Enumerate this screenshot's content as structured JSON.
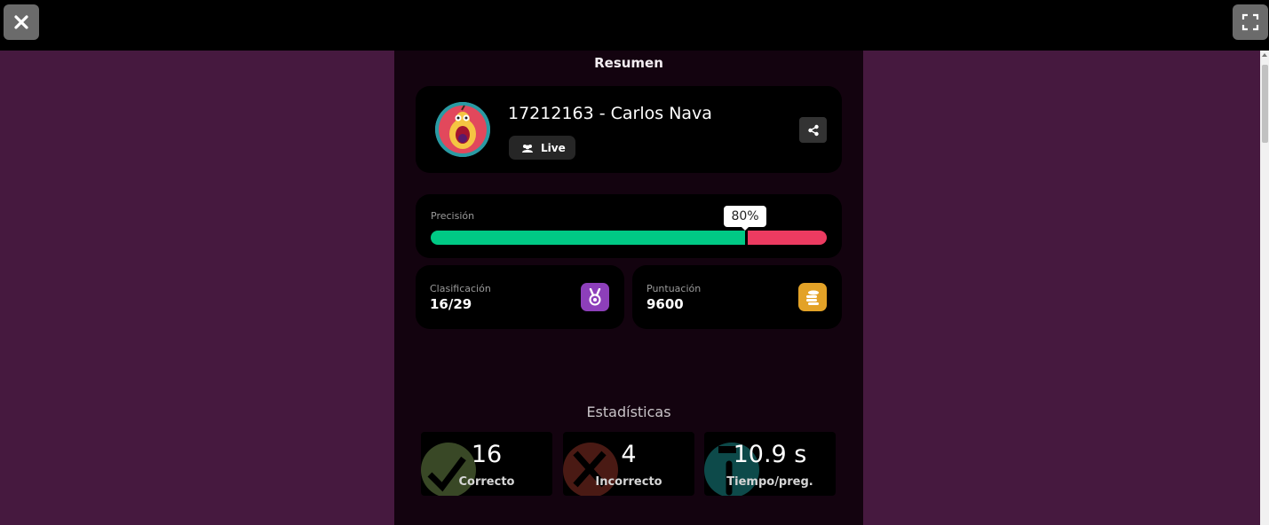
{
  "toolbar": {
    "close_icon": "close-icon",
    "fullscreen_icon": "fullscreen-icon"
  },
  "summary": {
    "title": "Resumen",
    "player_name": "17212163 - Carlos Nava",
    "mode_badge": "Live",
    "share_icon": "share-icon"
  },
  "accuracy": {
    "label": "Precisión",
    "percent_text": "80%",
    "correct_fraction": 0.8
  },
  "ranking": {
    "label": "Clasificación",
    "value": "16/29"
  },
  "score": {
    "label": "Puntuación",
    "value": "9600"
  },
  "statistics": {
    "title": "Estadísticas",
    "correct": {
      "value": "16",
      "label": "Correcto"
    },
    "incorrect": {
      "value": "4",
      "label": "Incorrecto"
    },
    "time": {
      "value": "10.9 s",
      "label": "Tiempo/preg."
    }
  },
  "colors": {
    "background": "#46193f",
    "panel": "#13030f",
    "correct": "#00c985",
    "incorrect": "#ec3b61",
    "rank_icon": "#8d3fba",
    "score_icon": "#e3a227"
  }
}
